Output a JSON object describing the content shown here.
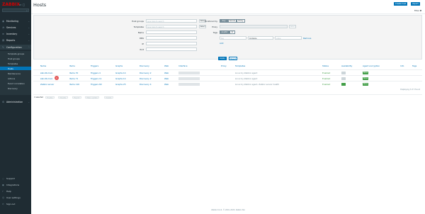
{
  "sidebar": {
    "logo": "ZABBIX",
    "nav": [
      {
        "label": "Monitoring",
        "icon": "eye-icon"
      },
      {
        "label": "Services",
        "icon": "services-icon"
      },
      {
        "label": "Inventory",
        "icon": "inventory-icon"
      },
      {
        "label": "Reports",
        "icon": "reports-icon"
      },
      {
        "label": "Configuration",
        "icon": "wrench-icon"
      }
    ],
    "config_items": [
      "Template groups",
      "Host groups",
      "Templates",
      "Hosts",
      "Maintenance",
      "Actions",
      "Event correlation",
      "Discovery"
    ],
    "admin_label": "Administration",
    "bottom": [
      "Support",
      "Integrations",
      "Help",
      "User settings",
      "Sign out"
    ]
  },
  "header": {
    "title": "Hosts",
    "create_btn": "Create host",
    "import_btn": "Import",
    "filter_tab": "Filter"
  },
  "filter": {
    "host_groups_label": "Host groups",
    "host_groups_placeholder": "type here to search",
    "templates_label": "Templates",
    "templates_placeholder": "type here to search",
    "select": "Select",
    "name_label": "Name",
    "dns_label": "DNS",
    "ip_label": "IP",
    "port_label": "Port",
    "monitored_by_label": "Monitored by",
    "monitored_by": [
      "Any",
      "Server",
      "Proxy"
    ],
    "proxy_label": "Proxy",
    "tags_label": "Tags",
    "tags_mode": [
      "And/Or",
      "Or"
    ],
    "tag_placeholder": "tag",
    "tag_operator": "Contains",
    "tag_value_placeholder": "value",
    "remove": "Remove",
    "add": "Add",
    "apply": "Apply",
    "reset": "Reset"
  },
  "table": {
    "headers": [
      "Name",
      "Items",
      "Triggers",
      "Graphs",
      "Discovery",
      "Web",
      "Interface",
      "Proxy",
      "Templates",
      "Status",
      "Availability",
      "Agent encryption",
      "Info",
      "Tags"
    ],
    "rows": [
      {
        "name": "zab-04.main",
        "items": "Items 70",
        "triggers": "Triggers 4",
        "graphs": "Graphs 14",
        "discovery": "Discovery 2",
        "web": "Web",
        "templates": "Linux by Zabbix agent",
        "status": "Enabled",
        "encryption": "None"
      },
      {
        "name": "zab-04.main",
        "items": "Items 71",
        "triggers": "Triggers 11",
        "graphs": "Graphs 14",
        "discovery": "Discovery 2",
        "web": "Web",
        "templates": "Linux by Zabbix agent",
        "status": "Enabled",
        "encryption": "None"
      },
      {
        "name": "Zabbix server",
        "items": "Items 116",
        "triggers": "Triggers 69",
        "graphs": "Graphs 25",
        "discovery": "Discovery 4",
        "web": "Web",
        "templates": "Linux by Zabbix agent, Zabbix server health",
        "status": "Enabled",
        "encryption": "None"
      }
    ],
    "badge": "1",
    "displaying": "Displaying 3 of 3 found"
  },
  "actions": [
    "0 selected",
    "Enable",
    "Disable",
    "Export",
    "Mass update",
    "Delete"
  ],
  "copyright": "Zabbix 6.4.4. © 2001–2023, Zabbix SIA",
  "colors": {
    "sidebar": "#1f2c33",
    "accent": "#0275b8",
    "green": "#429e47",
    "logo": "#d40000"
  }
}
